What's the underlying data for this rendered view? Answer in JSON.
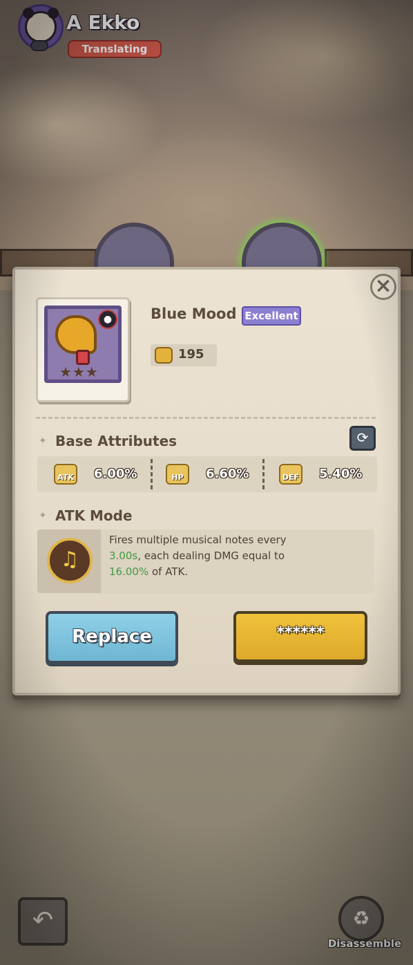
{
  "header": {
    "player_name": "A Ekko",
    "status": "Translating"
  },
  "item": {
    "name": "Blue Mood",
    "quality": "Excellent",
    "power_icon": "fist-icon",
    "power": "195",
    "stars": "★★★"
  },
  "base_attributes": {
    "title": "Base Attributes",
    "items": [
      {
        "label": "ATK",
        "value": "6.00%"
      },
      {
        "label": "HP",
        "value": "6.60%"
      },
      {
        "label": "DEF",
        "value": "5.40%"
      }
    ]
  },
  "atk_mode": {
    "title": "ATK Mode",
    "desc_part1": "Fires multiple musical notes every",
    "interval": "3.00s",
    "desc_part2": ", each dealing DMG equal to",
    "percent": "16.00%",
    "desc_part3": " of ATK."
  },
  "buttons": {
    "replace": "Replace",
    "secondary": "******",
    "disassemble": "Disassemble"
  },
  "colors": {
    "quality": "#8c7fd0",
    "highlight": "#3e9a44",
    "replace_button": "#7fc3dc",
    "gold_button": "#e6b431"
  }
}
